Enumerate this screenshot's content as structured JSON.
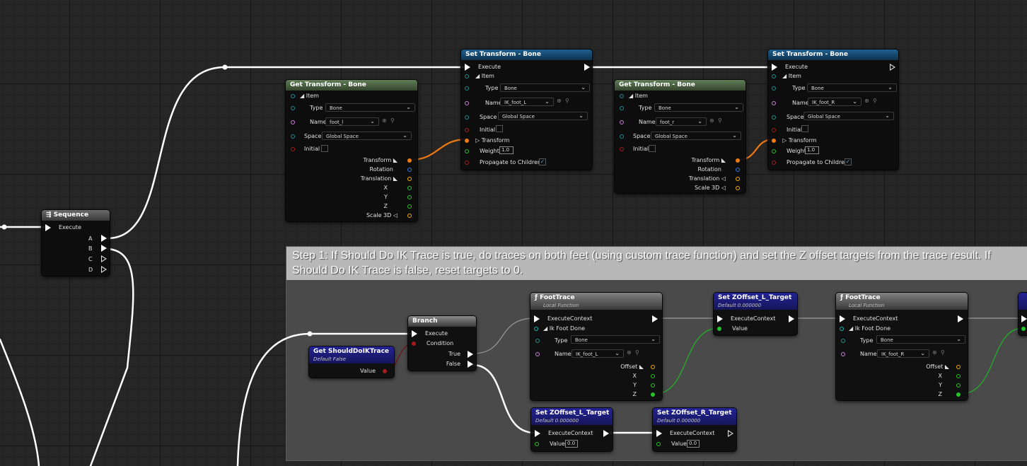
{
  "comment": {
    "text": "Step 1: If Should Do IK Trace is true, do traces on both feet (using custom trace function) and set the Z offset targets from the trace result. If Should Do IK Trace is false, reset targets to 0."
  },
  "sequence": {
    "title": "Sequence",
    "execute": "Execute",
    "outputs": [
      "A",
      "B",
      "C",
      "D"
    ]
  },
  "get_left": {
    "title": "Get Transform - Bone",
    "item": "Item",
    "type_label": "Type",
    "type_value": "Bone",
    "name_label": "Name",
    "name_value": "foot_l",
    "space_label": "Space",
    "space_value": "Global Space",
    "initial_label": "Initial",
    "transform": "Transform",
    "rotation": "Rotation",
    "translation": "Translation",
    "x": "X",
    "y": "Y",
    "z": "Z",
    "scale": "Scale 3D"
  },
  "set_left": {
    "title": "Set Transform - Bone",
    "execute": "Execute",
    "item": "Item",
    "type_label": "Type",
    "type_value": "Bone",
    "name_label": "Name",
    "name_value": "IK_foot_L",
    "space_label": "Space",
    "space_value": "Global Space",
    "initial_label": "Initial",
    "transform": "Transform",
    "weight_label": "Weight",
    "weight_value": "1.0",
    "propagate": "Propagate to Children"
  },
  "get_right": {
    "title": "Get Transform - Bone",
    "item": "Item",
    "type_label": "Type",
    "type_value": "Bone",
    "name_label": "Name",
    "name_value": "foot_r",
    "space_label": "Space",
    "space_value": "Global Space",
    "initial_label": "Initial",
    "transform": "Transform",
    "rotation": "Rotation",
    "translation": "Translation",
    "scale": "Scale 3D"
  },
  "set_right": {
    "title": "Set Transform - Bone",
    "execute": "Execute",
    "item": "Item",
    "type_label": "Type",
    "type_value": "Bone",
    "name_label": "Name",
    "name_value": "IK_foot_R",
    "space_label": "Space",
    "space_value": "Global Space",
    "initial_label": "Initial",
    "transform": "Transform",
    "weight_label": "Weight",
    "weight_value": "1.0",
    "propagate": "Propagate to Children"
  },
  "get_should": {
    "title": "Get ShouldDoIKTrace",
    "subtitle": "Default False",
    "value": "Value"
  },
  "branch": {
    "title": "Branch",
    "execute": "Execute",
    "condition": "Condition",
    "true": "True",
    "false": "False"
  },
  "foot_trace_l": {
    "title": "FootTrace",
    "subtitle": "Local Function",
    "exec_ctx": "ExecuteContext",
    "foot_done": "Ik Foot Done",
    "type_label": "Type",
    "type_value": "Bone",
    "name_label": "Name",
    "name_value": "IK_foot_L",
    "offset": "Offset",
    "x": "X",
    "y": "Y",
    "z": "Z"
  },
  "set_z_l_top": {
    "title": "Set ZOffset_L_Target",
    "subtitle": "Default 0.000000",
    "exec_ctx": "ExecuteContext",
    "value": "Value"
  },
  "foot_trace_r": {
    "title": "FootTrace",
    "subtitle": "Local Function",
    "exec_ctx": "ExecuteContext",
    "foot_done": "Ik Foot Done",
    "type_label": "Type",
    "type_value": "Bone",
    "name_label": "Name",
    "name_value": "IK_foot_R",
    "offset": "Offset",
    "x": "X",
    "y": "Y",
    "z": "Z"
  },
  "set_z_l_bottom": {
    "title": "Set ZOffset_L_Target",
    "subtitle": "Default 0.000000",
    "exec_ctx": "ExecuteContext",
    "value_label": "Value",
    "value": "0.0"
  },
  "set_z_r_bottom": {
    "title": "Set ZOffset_R_Target",
    "subtitle": "Default 0.000000",
    "exec_ctx": "ExecuteContext",
    "value_label": "Value",
    "value": "0.0"
  },
  "colors": {
    "exec": "#ffffff",
    "transform": "#f07a12",
    "vector": "#f5ad00",
    "rotation": "#2a7ce0",
    "float": "#26c42a",
    "bool": "#a51d1d",
    "name": "#cf7cd8",
    "struct": "#19b9b9"
  },
  "icons": [
    "sequence-icon",
    "function-icon",
    "dropdown-chevron-icon",
    "browse-icon",
    "search-icon",
    "checkmark-icon"
  ]
}
